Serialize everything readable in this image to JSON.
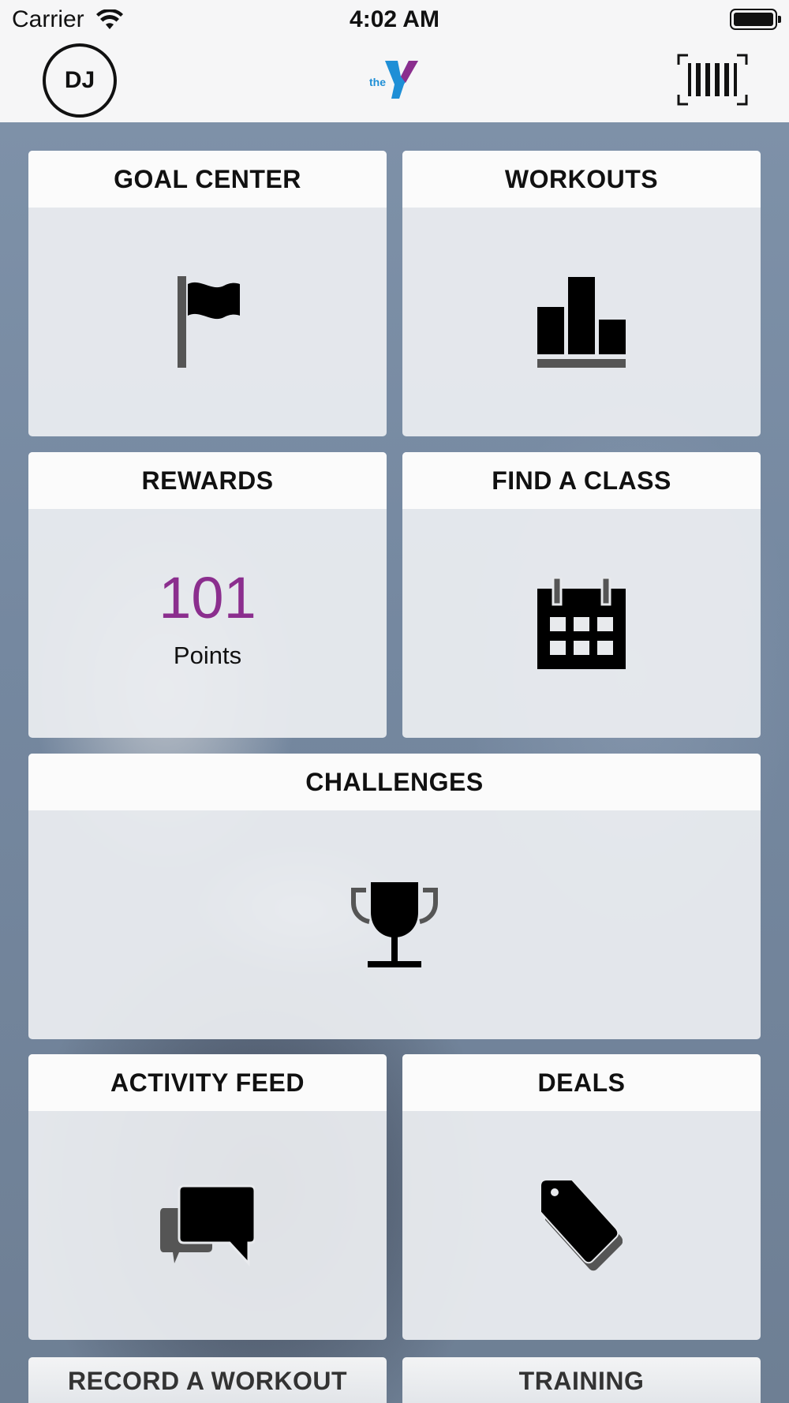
{
  "status_bar": {
    "carrier": "Carrier",
    "time": "4:02 AM"
  },
  "nav": {
    "avatar_initials": "DJ",
    "logo_text": "the",
    "icons": [
      "wifi-icon",
      "battery-icon",
      "ymca-logo",
      "barcode-icon"
    ]
  },
  "tiles": {
    "goal_center": {
      "title": "GOAL CENTER",
      "icon": "flag-icon"
    },
    "workouts": {
      "title": "WORKOUTS",
      "icon": "bar-chart-icon"
    },
    "rewards": {
      "title": "REWARDS",
      "value": "101",
      "unit": "Points"
    },
    "find_class": {
      "title": "FIND A CLASS",
      "icon": "calendar-icon"
    },
    "challenges": {
      "title": "CHALLENGES",
      "icon": "trophy-icon"
    },
    "activity_feed": {
      "title": "ACTIVITY FEED",
      "icon": "chat-bubbles-icon"
    },
    "deals": {
      "title": "DEALS",
      "icon": "tag-icon"
    },
    "record_workout": {
      "title": "RECORD A WORKOUT"
    },
    "training": {
      "title": "TRAINING"
    }
  },
  "colors": {
    "rewards_accent": "#8b2e8e",
    "logo_blue": "#1f8fd6",
    "logo_purple": "#8b2e8e"
  }
}
